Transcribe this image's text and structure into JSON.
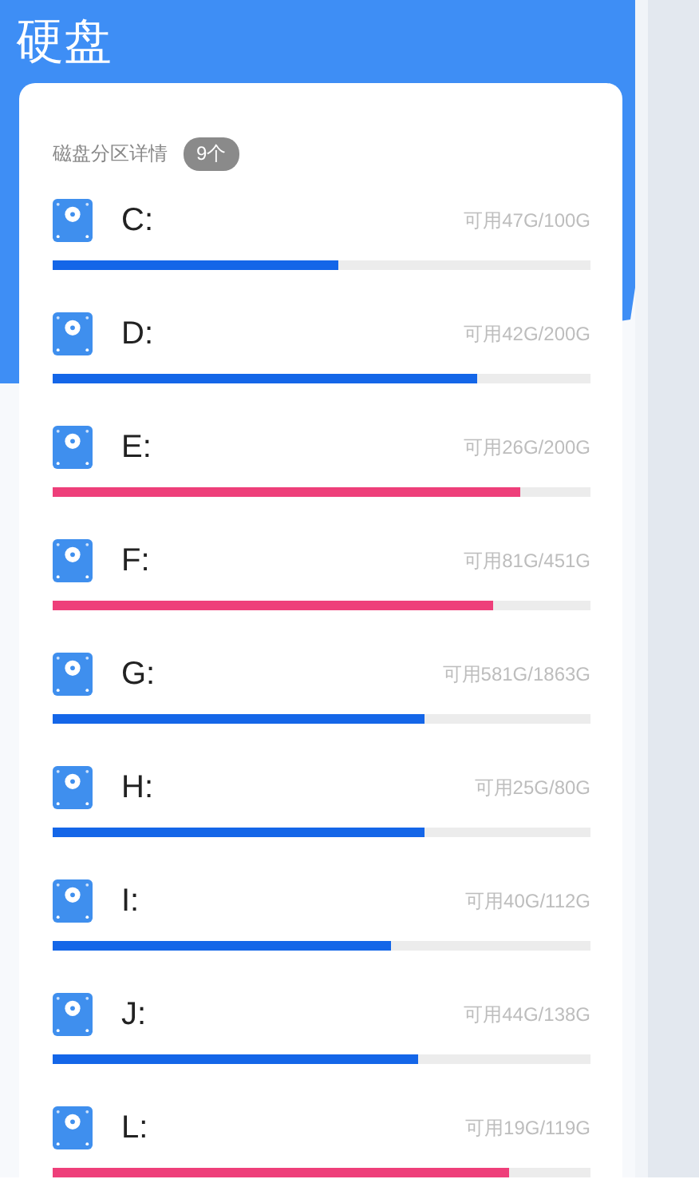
{
  "header": {
    "title": "硬盘"
  },
  "partitions": {
    "heading": "磁盘分区详情",
    "count": "9个",
    "items": [
      {
        "name": "C:",
        "usage": "可用47G/100G",
        "level": 0.53,
        "color": "#1466e8"
      },
      {
        "name": "D:",
        "usage": "可用42G/200G",
        "level": 0.79,
        "color": "#1466e8"
      },
      {
        "name": "E:",
        "usage": "可用26G/200G",
        "level": 0.87,
        "color": "#ee3f7a"
      },
      {
        "name": "F:",
        "usage": "可用81G/451G",
        "level": 0.82,
        "color": "#ee3f7a"
      },
      {
        "name": "G:",
        "usage": "可用581G/1863G",
        "level": 0.69,
        "color": "#1466e8"
      },
      {
        "name": "H:",
        "usage": "可用25G/80G",
        "level": 0.69,
        "color": "#1466e8"
      },
      {
        "name": "I:",
        "usage": "可用40G/112G",
        "level": 0.63,
        "color": "#1466e8"
      },
      {
        "name": "J:",
        "usage": "可用44G/138G",
        "level": 0.68,
        "color": "#1466e8"
      },
      {
        "name": "L:",
        "usage": "可用19G/119G",
        "level": 0.85,
        "color": "#ee3f7a"
      }
    ]
  }
}
